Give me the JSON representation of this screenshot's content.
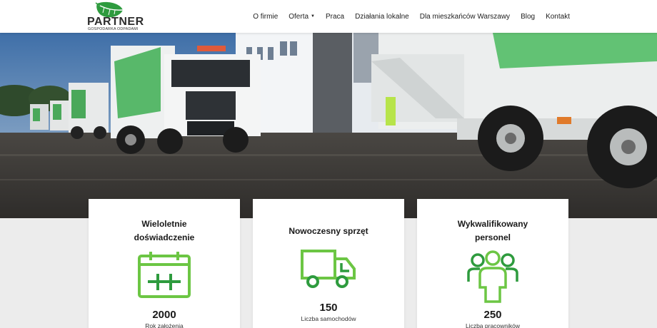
{
  "brand": {
    "name": "PARTNER",
    "tagline": "GOSPODARKA ODPADAMI",
    "color": "#2e9b3e"
  },
  "nav": {
    "items": [
      {
        "label": "O firmie"
      },
      {
        "label": "Oferta",
        "has_dropdown": true
      },
      {
        "label": "Praca"
      },
      {
        "label": "Działania lokalne"
      },
      {
        "label": "Dla mieszkańców Warszawy"
      },
      {
        "label": "Blog"
      },
      {
        "label": "Kontakt"
      }
    ]
  },
  "hero": {
    "image": "garbage-trucks-photo"
  },
  "cards": [
    {
      "title": "Wieloletnie doświadczenie",
      "icon": "calendar-icon",
      "value": "2000",
      "label": "Rok założenia"
    },
    {
      "title": "Nowoczesny sprzęt",
      "icon": "truck-icon",
      "value": "150",
      "label": "Liczba samochodów"
    },
    {
      "title": "Wykwalifikowany personel",
      "icon": "people-icon",
      "value": "250",
      "label": "Liczba pracowników"
    }
  ],
  "colors": {
    "icon_light": "#6cc644",
    "icon_dark": "#2e9b3e"
  }
}
